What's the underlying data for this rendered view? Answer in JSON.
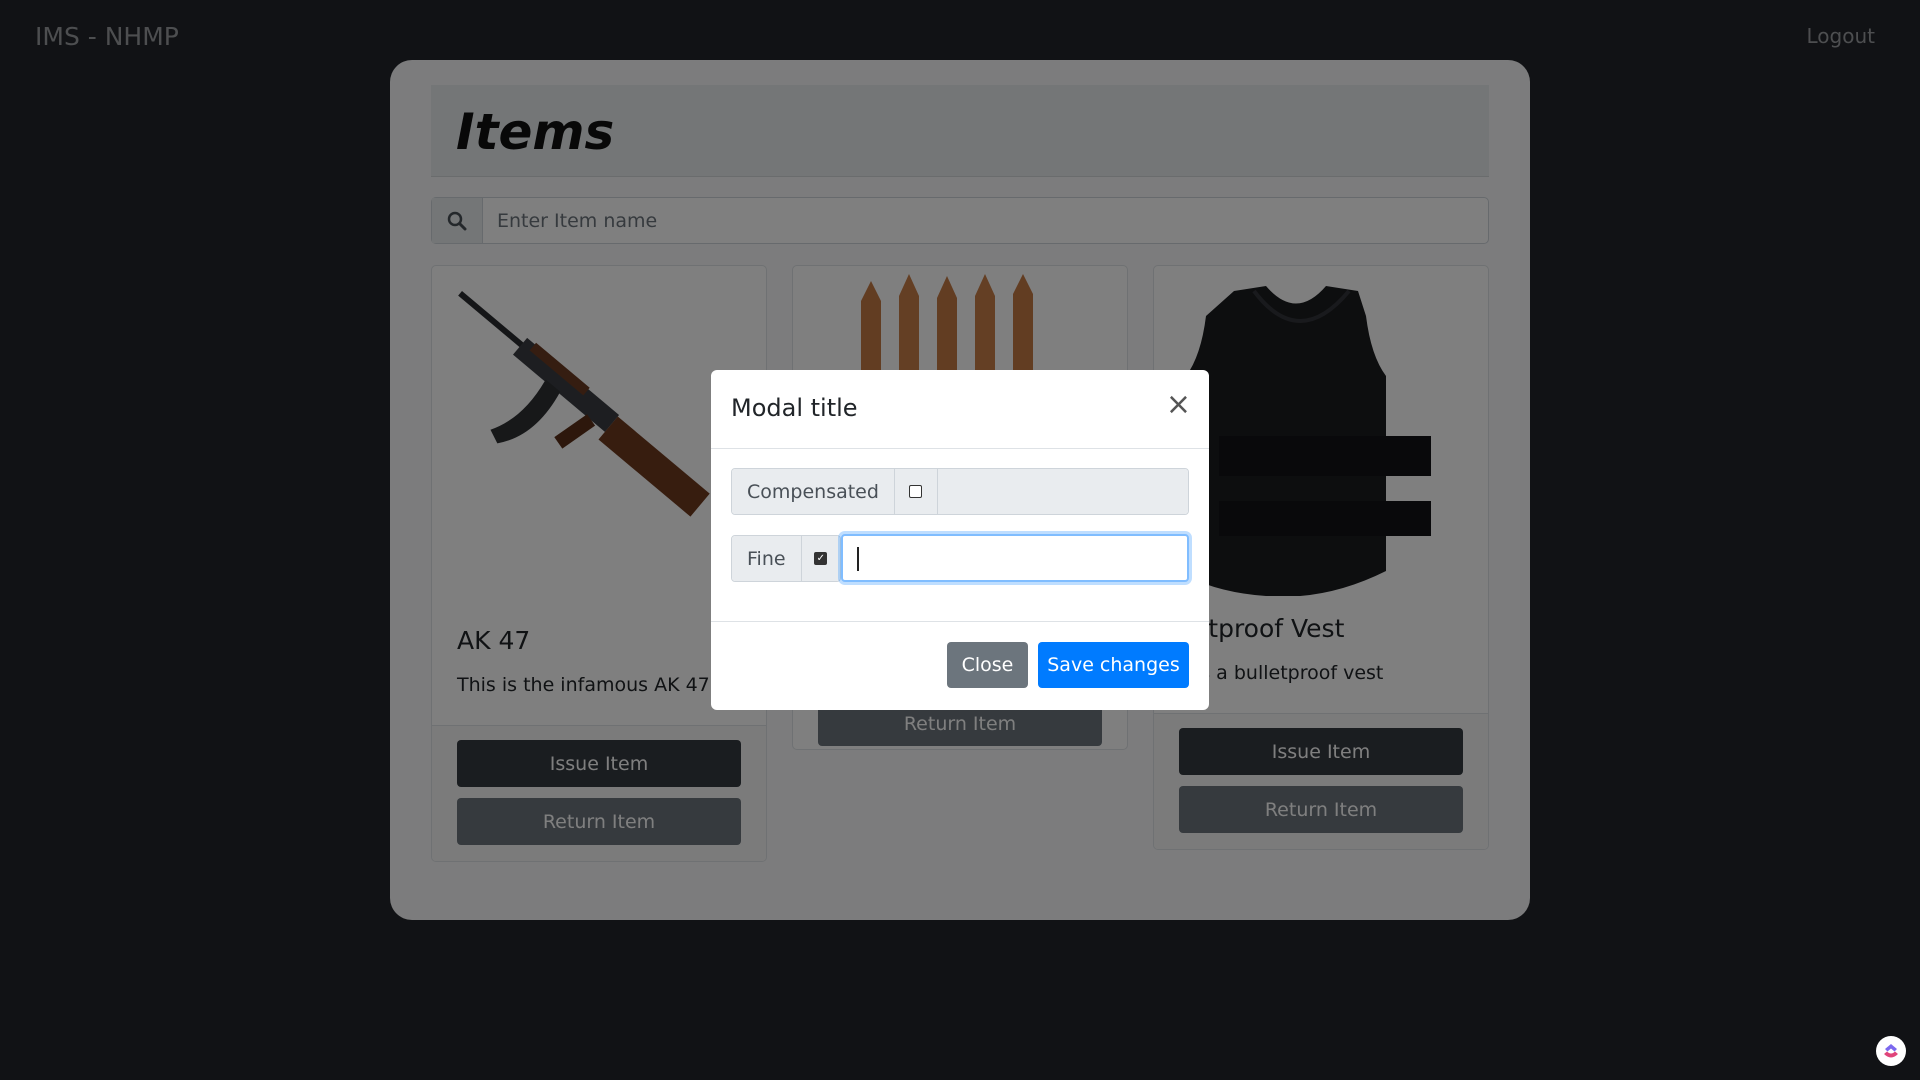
{
  "nav": {
    "brand": "IMS - NHMP",
    "logout": "Logout"
  },
  "page": {
    "title": "Items"
  },
  "search": {
    "placeholder": "Enter Item name",
    "icon": "search-icon"
  },
  "cards": [
    {
      "title": "AK 47",
      "description": "This is the infamous AK 47",
      "issue_label": "Issue Item",
      "return_label": "Return Item"
    },
    {
      "title": "",
      "description": "",
      "issue_label": "",
      "return_label": "Return Item"
    },
    {
      "title": "lletproof Vest",
      "description": "s is a bulletproof vest",
      "issue_label": "Issue Item",
      "return_label": "Return Item"
    }
  ],
  "modal": {
    "title": "Modal title",
    "close_glyph": "×",
    "fields": [
      {
        "label": "Compensated",
        "checked": false,
        "value": ""
      },
      {
        "label": "Fine",
        "checked": true,
        "value": ""
      }
    ],
    "close_button": "Close",
    "save_button": "Save changes"
  },
  "colors": {
    "primary": "#007bff",
    "dark": "#343a40",
    "secondary": "#6c757d",
    "background": "#22252a"
  }
}
